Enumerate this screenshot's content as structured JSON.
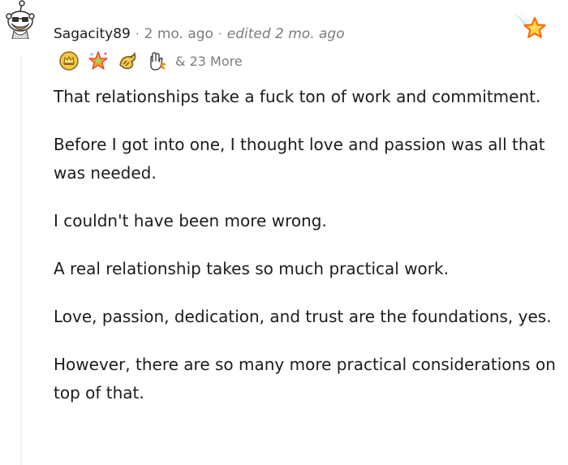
{
  "comment": {
    "author": "Sagacity89",
    "time": "2 mo. ago",
    "edited": "edited 2 mo. ago",
    "separator": "·",
    "more_awards": "& 23 More",
    "awards": [
      "crown-award-icon",
      "rainbow-star-award-icon",
      "dragon-award-icon",
      "hand-clap-award-icon"
    ],
    "paragraphs": [
      "That relationships take a fuck ton of work and commitment.",
      "Before I got into one, I thought love and passion was all that was needed.",
      "I couldn't have been more wrong.",
      "A real relationship takes so much practical work.",
      "Love, passion, dedication, and trust are the foundations, yes.",
      "However, there are so many more practical considerations on top of that."
    ]
  },
  "colors": {
    "text": "#1c1c1c",
    "meta": "#7c7c7c",
    "thread_line": "#edeff1",
    "star_orange": "#ff8c1a",
    "star_gold": "#ffd84d"
  }
}
